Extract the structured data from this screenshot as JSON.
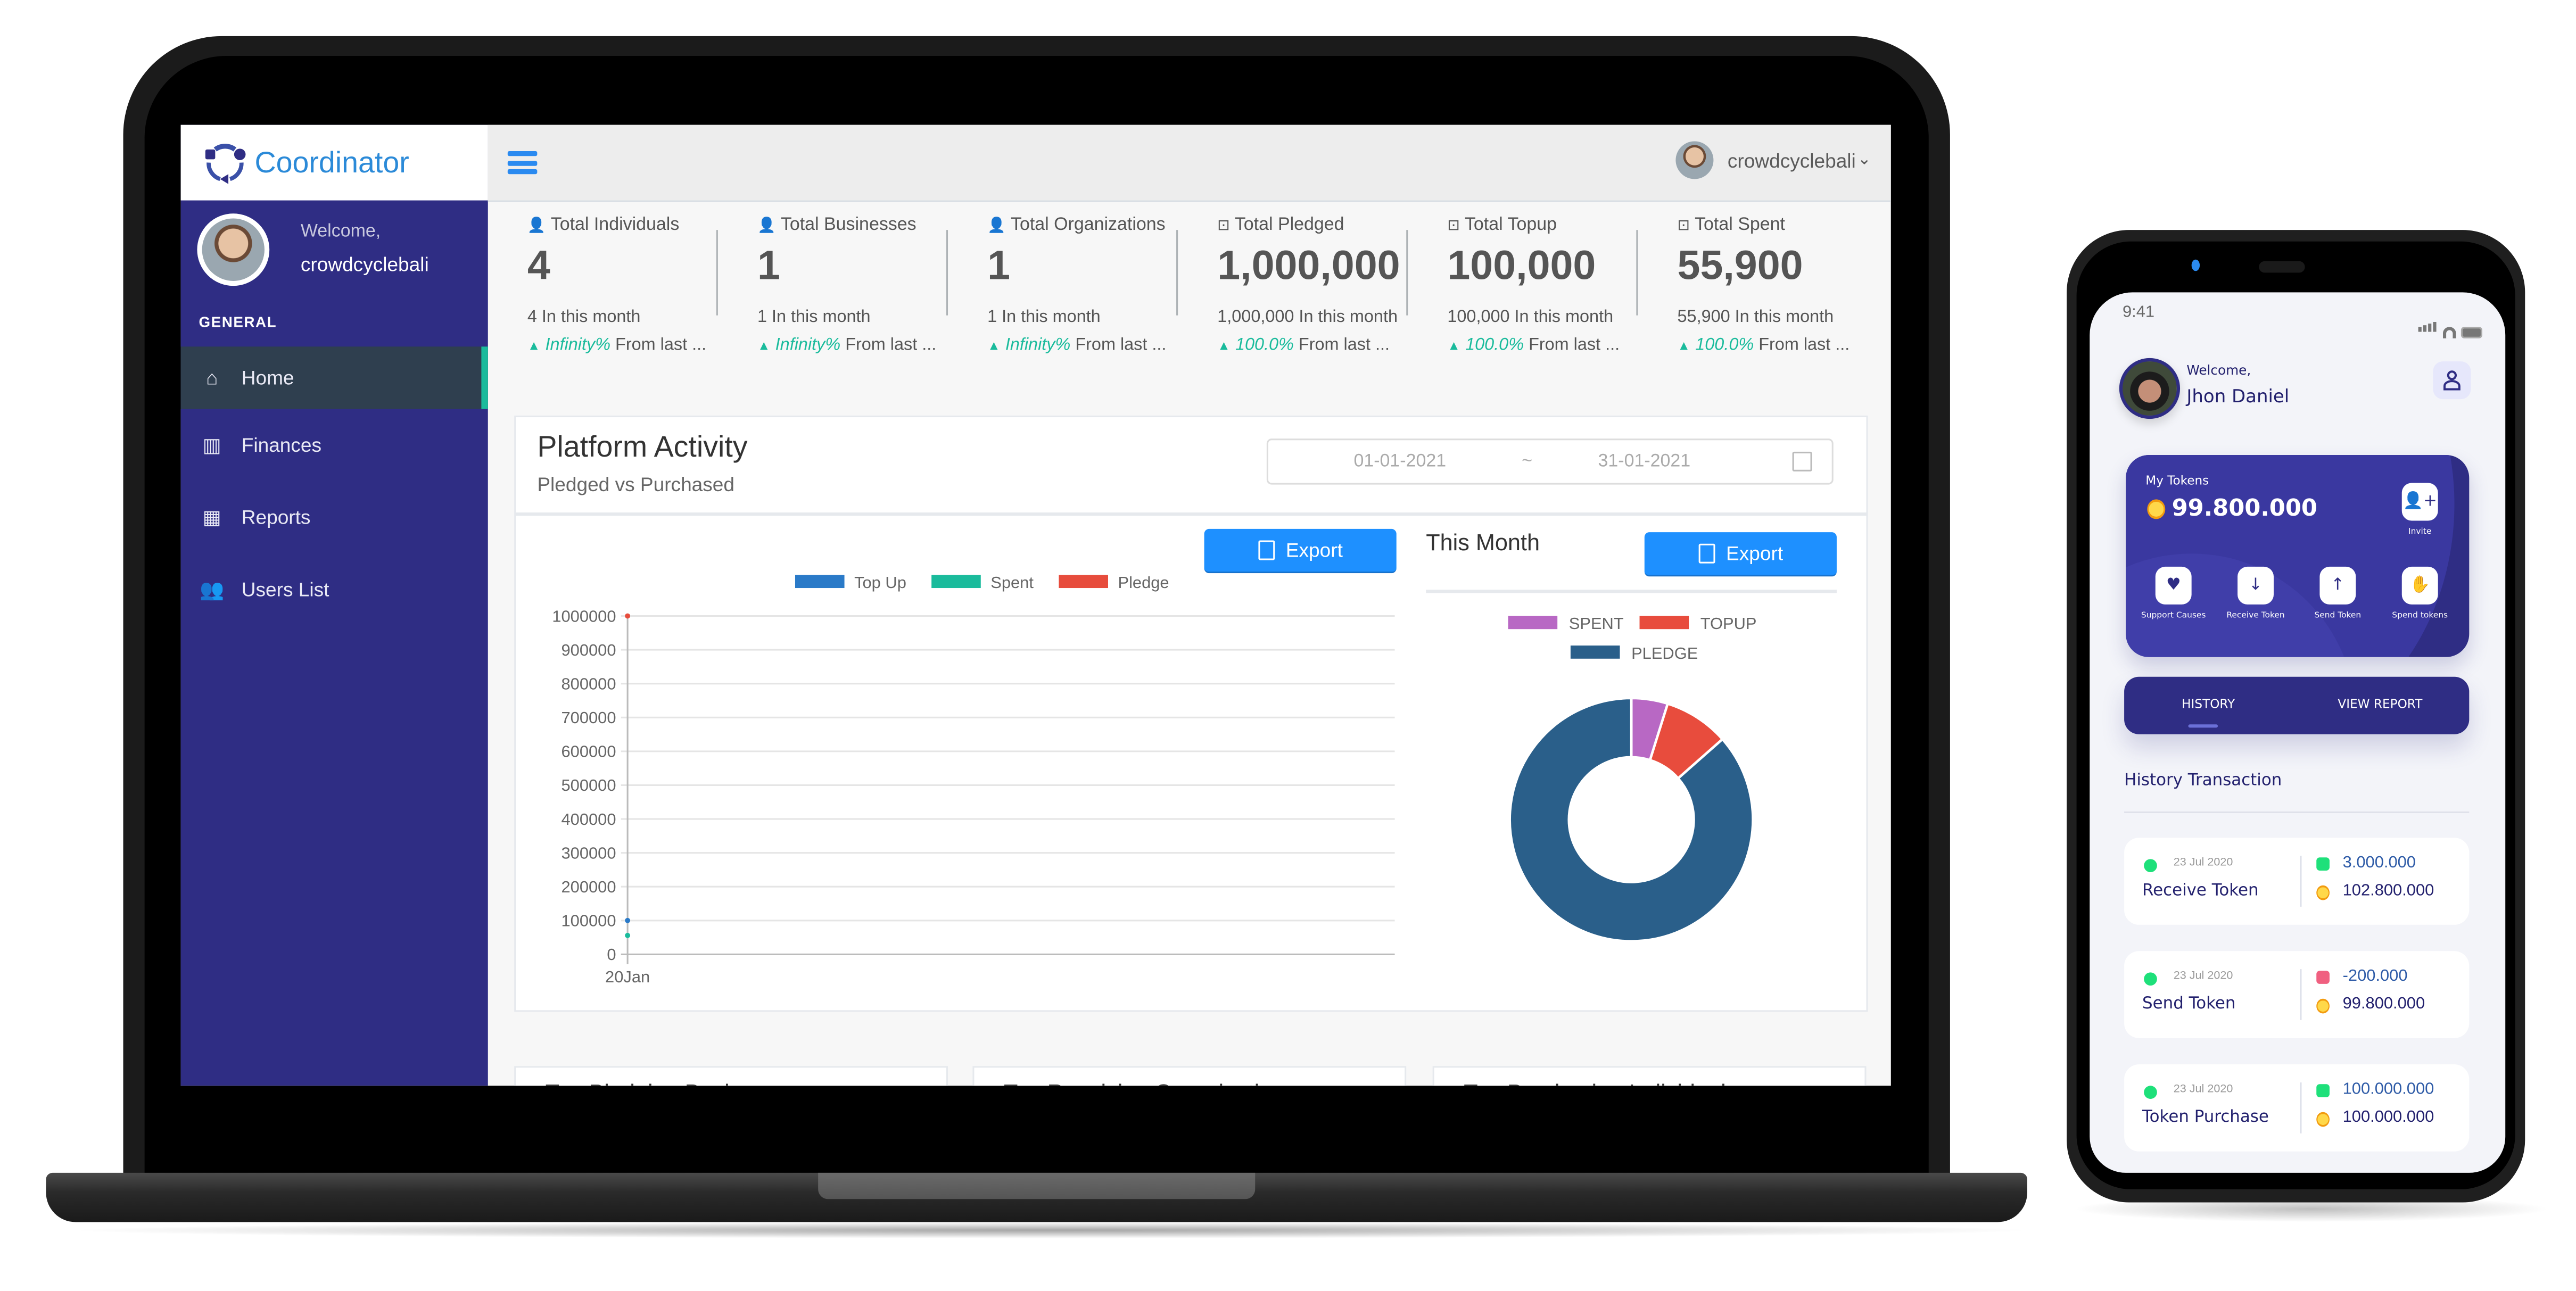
{
  "laptop": {
    "brand": {
      "name": "Coordinator",
      "logo_icon": "coordinator-logo-icon"
    },
    "sidebar": {
      "welcome": "Welcome,",
      "username": "crowdcyclebali",
      "section_label": "GENERAL",
      "items": [
        {
          "label": "Home",
          "icon": "home-icon",
          "glyph": "⌂",
          "active": true
        },
        {
          "label": "Finances",
          "icon": "bar-chart-icon",
          "glyph": "▥",
          "active": false
        },
        {
          "label": "Reports",
          "icon": "table-icon",
          "glyph": "▦",
          "active": false
        },
        {
          "label": "Users List",
          "icon": "users-icon",
          "glyph": "👥",
          "active": false
        }
      ]
    },
    "topbar": {
      "menu_icon": "hamburger-icon",
      "user_name": "crowdcyclebali",
      "dropdown_glyph": "⌄"
    },
    "stats": [
      {
        "label": "Total Individuals",
        "icon": "user-icon",
        "glyph": "👤",
        "value": "4",
        "month": "4 In this month",
        "change_pct": "Infinity%",
        "change_text": " From last ..."
      },
      {
        "label": "Total Businesses",
        "icon": "user-icon",
        "glyph": "👤",
        "value": "1",
        "month": "1 In this month",
        "change_pct": "Infinity%",
        "change_text": " From last ..."
      },
      {
        "label": "Total Organizations",
        "icon": "user-icon",
        "glyph": "👤",
        "value": "1",
        "month": "1 In this month",
        "change_pct": "Infinity%",
        "change_text": " From last ..."
      },
      {
        "label": "Total Pledged",
        "icon": "money-icon",
        "glyph": "⊡",
        "value": "1,000,000",
        "month": "1,000,000 In this month",
        "change_pct": "100.0%",
        "change_text": " From last ..."
      },
      {
        "label": "Total Topup",
        "icon": "money-icon",
        "glyph": "⊡",
        "value": "100,000",
        "month": "100,000 In this month",
        "change_pct": "100.0%",
        "change_text": " From last ..."
      },
      {
        "label": "Total Spent",
        "icon": "money-icon",
        "glyph": "⊡",
        "value": "55,900",
        "month": "55,900 In this month",
        "change_pct": "100.0%",
        "change_text": " From last ..."
      }
    ],
    "panel": {
      "title": "Platform Activity",
      "subtitle": "Pledged vs Purchased",
      "date_start": "01-01-2021",
      "date_separator": "~",
      "date_end": "31-01-2021",
      "export_label": "Export",
      "this_month_label": "This Month",
      "export2_label": "Export"
    },
    "bottom_cards": [
      {
        "title": "Top Pledging Businesses"
      },
      {
        "title": "Top Receiving Organizations"
      },
      {
        "title": "Top Purchasing Individuals"
      }
    ]
  },
  "chart_data": [
    {
      "type": "line",
      "title": "Platform Activity",
      "x": [
        "20Jan"
      ],
      "series": [
        {
          "name": "Top Up",
          "color": "#2a7ac8",
          "values": [
            100000
          ]
        },
        {
          "name": "Spent",
          "color": "#1abb9c",
          "values": [
            55900
          ]
        },
        {
          "name": "Pledge",
          "color": "#e74c3c",
          "values": [
            1000000
          ]
        }
      ],
      "ylim": [
        0,
        1000000
      ],
      "yticks": [
        0,
        100000,
        200000,
        300000,
        400000,
        500000,
        600000,
        700000,
        800000,
        900000,
        1000000
      ],
      "grid": true,
      "legend": "top-center"
    },
    {
      "type": "pie",
      "title": "This Month",
      "donut": true,
      "labels": [
        "SPENT",
        "TOPUP",
        "PLEDGE"
      ],
      "values": [
        55900,
        100000,
        1000000
      ],
      "colors": [
        "#b868c4",
        "#e84c3d",
        "#2a5f8a"
      ],
      "legend": "top"
    }
  ],
  "phone": {
    "status_time": "9:41",
    "welcome": "Welcome,",
    "name": "Jhon Daniel",
    "tokens_label": "My Tokens",
    "tokens_amount": "99.800.000",
    "actions": [
      {
        "label": "Invite",
        "icon": "invite-user-icon",
        "glyph": "👤+"
      },
      {
        "label": "Support Causes",
        "icon": "support-causes-icon",
        "glyph": "♥"
      },
      {
        "label": "Receive Token",
        "icon": "receive-wallet-icon",
        "glyph": "↓"
      },
      {
        "label": "Send Token",
        "icon": "send-wallet-icon",
        "glyph": "↑"
      },
      {
        "label": "Spend tokens",
        "icon": "spend-money-icon",
        "glyph": "✋"
      }
    ],
    "tabs": [
      {
        "label": "HISTORY",
        "active": true
      },
      {
        "label": "VIEW REPORT",
        "active": false
      }
    ],
    "history_title": "History Transaction",
    "transactions": [
      {
        "date": "23 Jul 2020",
        "name": "Receive Token",
        "delta": "3.000.000",
        "direction": "in",
        "balance": "102.800.000"
      },
      {
        "date": "23 Jul 2020",
        "name": "Send Token",
        "delta": "-200.000",
        "direction": "out",
        "balance": "99.800.000"
      },
      {
        "date": "23 Jul 2020",
        "name": "Token Purchase",
        "delta": "100.000.000",
        "direction": "in",
        "balance": "100.000.000"
      }
    ]
  }
}
